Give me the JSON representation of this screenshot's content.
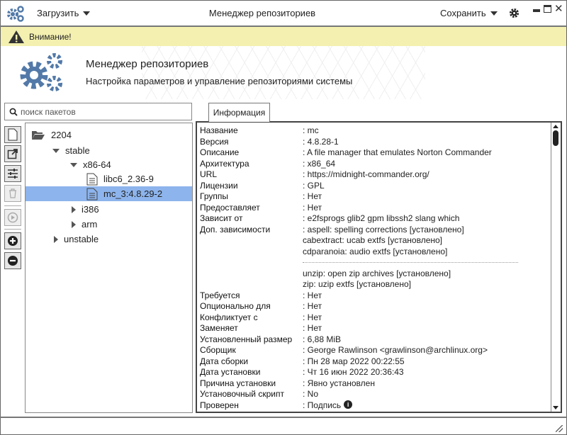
{
  "window": {
    "title": "Менеджер репозиториев"
  },
  "menu": {
    "load": "Загрузить",
    "save": "Сохранить"
  },
  "warning": {
    "text": "Внимание!"
  },
  "header": {
    "title": "Менеджер репозиториев",
    "subtitle": "Настройка параметров и управление репозиториями системы"
  },
  "search": {
    "placeholder": "поиск пакетов"
  },
  "tabs": [
    {
      "label": "Информация",
      "active": true
    }
  ],
  "tree": {
    "root": "2204",
    "stable": "stable",
    "x86": "x86-64",
    "pkg1": "libc6_2.36-9",
    "pkg2": "mc_3:4.8.29-2",
    "i386": "i386",
    "arm": "arm",
    "unstable": "unstable",
    "selected": "mc_3:4.8.29-2"
  },
  "info": {
    "rows1": [
      {
        "label": "Название",
        "value": ": mc"
      },
      {
        "label": "Версия",
        "value": ": 4.8.28-1"
      },
      {
        "label": "Описание",
        "value": ": A file manager that emulates Norton Commander"
      },
      {
        "label": "Архитектура",
        "value": ": x86_64"
      },
      {
        "label": "URL",
        "value": ": https://midnight-commander.org/"
      },
      {
        "label": "Лицензии",
        "value": ": GPL"
      },
      {
        "label": "Группы",
        "value": ": Нет"
      },
      {
        "label": "Предоставляет",
        "value": ": Нет"
      },
      {
        "label": "Зависит от",
        "value": ": e2fsprogs  glib2  gpm  libssh2  slang  which"
      },
      {
        "label": "Доп. зависимости",
        "value": ": aspell: spelling corrections [установлено]"
      }
    ],
    "deps_more": [
      "cabextract: ucab extfs [установлено]",
      "cdparanoia: audio extfs [установлено]"
    ],
    "deps_after": [
      "unzip: open zip archives [установлено]",
      "zip: uzip extfs [установлено]"
    ],
    "rows2": [
      {
        "label": "Требуется",
        "value": ": Нет"
      },
      {
        "label": "Опционально для",
        "value": ": Нет"
      },
      {
        "label": "Конфликтует с",
        "value": ": Нет"
      },
      {
        "label": "Заменяет",
        "value": ": Нет"
      },
      {
        "label": "Установленный размер",
        "value": ": 6,88 MiB"
      },
      {
        "label": "Сборщик",
        "value": ": George Rawlinson <grawlinson@archlinux.org>"
      },
      {
        "label": "Дата сборки",
        "value": ": Пн 28 мар 2022 00:22:55"
      },
      {
        "label": "Дата установки",
        "value": ": Чт 16 июн 2022 20:36:43"
      },
      {
        "label": "Причина установки",
        "value": ": Явно установлен"
      },
      {
        "label": "Установочный скрипт",
        "value": ": No"
      },
      {
        "label": "Проверен",
        "value": ": Подпись"
      }
    ]
  },
  "colors": {
    "accent": "#5279a8",
    "warning_bg": "#f3f0b0",
    "selection": "#8db4ec"
  }
}
